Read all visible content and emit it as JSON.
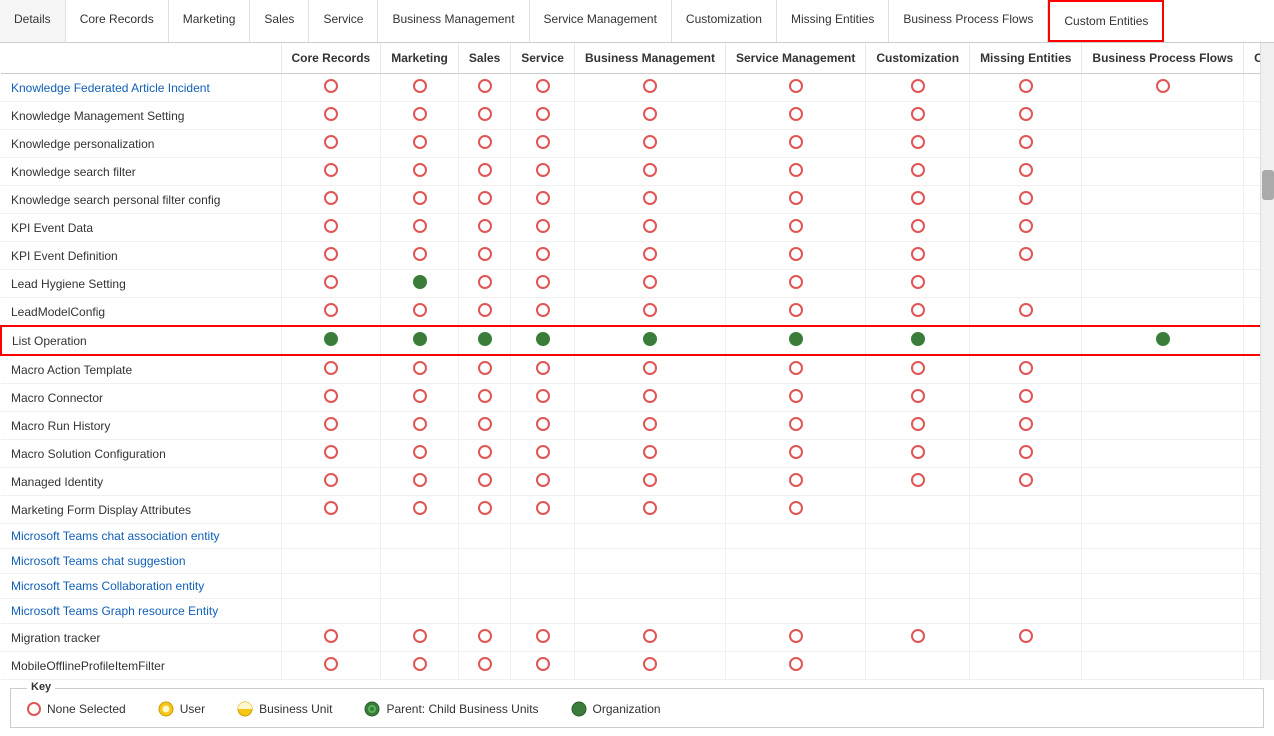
{
  "tabs": [
    {
      "id": "details",
      "label": "Details",
      "active": false
    },
    {
      "id": "core-records",
      "label": "Core Records",
      "active": false
    },
    {
      "id": "marketing",
      "label": "Marketing",
      "active": false
    },
    {
      "id": "sales",
      "label": "Sales",
      "active": false
    },
    {
      "id": "service",
      "label": "Service",
      "active": false
    },
    {
      "id": "business-management",
      "label": "Business Management",
      "active": false
    },
    {
      "id": "service-management",
      "label": "Service Management",
      "active": false
    },
    {
      "id": "customization",
      "label": "Customization",
      "active": false
    },
    {
      "id": "missing-entities",
      "label": "Missing Entities",
      "active": false
    },
    {
      "id": "business-process-flows",
      "label": "Business Process Flows",
      "active": false
    },
    {
      "id": "custom-entities",
      "label": "Custom Entities",
      "active": false,
      "highlighted": true
    }
  ],
  "columns": [
    "Core Records",
    "Marketing",
    "Sales",
    "Service",
    "Business Management",
    "Service Management",
    "Customization",
    "Missing Entities",
    "Business Process Flows",
    "Custom Entities"
  ],
  "rows": [
    {
      "name": "Knowledge Federated Article Incident",
      "nameType": "blue-link",
      "circles": [
        "none",
        "none",
        "none",
        "none",
        "none",
        "none",
        "none",
        "none",
        "none",
        ""
      ]
    },
    {
      "name": "Knowledge Management Setting",
      "nameType": "black",
      "circles": [
        "none",
        "none",
        "none",
        "none",
        "none",
        "none",
        "none",
        "none",
        "",
        ""
      ]
    },
    {
      "name": "Knowledge personalization",
      "nameType": "black",
      "circles": [
        "none",
        "none",
        "none",
        "none",
        "none",
        "none",
        "none",
        "none",
        "",
        ""
      ]
    },
    {
      "name": "Knowledge search filter",
      "nameType": "black",
      "circles": [
        "none",
        "none",
        "none",
        "none",
        "none",
        "none",
        "none",
        "none",
        "",
        ""
      ]
    },
    {
      "name": "Knowledge search personal filter config",
      "nameType": "black",
      "circles": [
        "none",
        "none",
        "none",
        "none",
        "none",
        "none",
        "none",
        "none",
        "",
        ""
      ]
    },
    {
      "name": "KPI Event Data",
      "nameType": "black",
      "circles": [
        "none",
        "none",
        "none",
        "none",
        "none",
        "none",
        "none",
        "none",
        "",
        ""
      ]
    },
    {
      "name": "KPI Event Definition",
      "nameType": "black",
      "circles": [
        "none",
        "none",
        "none",
        "none",
        "none",
        "none",
        "none",
        "none",
        "",
        ""
      ]
    },
    {
      "name": "Lead Hygiene Setting",
      "nameType": "black",
      "circles": [
        "none",
        "green",
        "none",
        "none",
        "none",
        "none",
        "none",
        "",
        "",
        ""
      ]
    },
    {
      "name": "LeadModelConfig",
      "nameType": "black",
      "circles": [
        "none",
        "none",
        "none",
        "none",
        "none",
        "none",
        "none",
        "none",
        "",
        ""
      ]
    },
    {
      "name": "List Operation",
      "nameType": "black",
      "circles": [
        "green",
        "green",
        "green",
        "green",
        "green",
        "green",
        "green",
        "",
        "green",
        ""
      ],
      "highlighted": true
    },
    {
      "name": "Macro Action Template",
      "nameType": "black",
      "circles": [
        "none",
        "none",
        "none",
        "none",
        "none",
        "none",
        "none",
        "none",
        "",
        ""
      ]
    },
    {
      "name": "Macro Connector",
      "nameType": "black",
      "circles": [
        "none",
        "none",
        "none",
        "none",
        "none",
        "none",
        "none",
        "none",
        "",
        ""
      ]
    },
    {
      "name": "Macro Run History",
      "nameType": "black",
      "circles": [
        "none",
        "none",
        "none",
        "none",
        "none",
        "none",
        "none",
        "none",
        "",
        ""
      ]
    },
    {
      "name": "Macro Solution Configuration",
      "nameType": "black",
      "circles": [
        "none",
        "none",
        "none",
        "none",
        "none",
        "none",
        "none",
        "none",
        "",
        ""
      ]
    },
    {
      "name": "Managed Identity",
      "nameType": "black",
      "circles": [
        "none",
        "none",
        "none",
        "none",
        "none",
        "none",
        "none",
        "none",
        "",
        ""
      ]
    },
    {
      "name": "Marketing Form Display Attributes",
      "nameType": "black",
      "circles": [
        "none",
        "none",
        "none",
        "none",
        "none",
        "none",
        "",
        "",
        "",
        ""
      ]
    },
    {
      "name": "Microsoft Teams chat association entity",
      "nameType": "blue-link",
      "circles": [
        "",
        "",
        "",
        "",
        "",
        "",
        "",
        "",
        "",
        ""
      ]
    },
    {
      "name": "Microsoft Teams chat suggestion",
      "nameType": "blue-link",
      "circles": [
        "",
        "",
        "",
        "",
        "",
        "",
        "",
        "",
        "",
        ""
      ]
    },
    {
      "name": "Microsoft Teams Collaboration entity",
      "nameType": "blue-link",
      "circles": [
        "",
        "",
        "",
        "",
        "",
        "",
        "",
        "",
        "",
        ""
      ]
    },
    {
      "name": "Microsoft Teams Graph resource Entity",
      "nameType": "blue-link",
      "circles": [
        "",
        "",
        "",
        "",
        "",
        "",
        "",
        "",
        "",
        ""
      ]
    },
    {
      "name": "Migration tracker",
      "nameType": "black",
      "circles": [
        "none",
        "none",
        "none",
        "none",
        "none",
        "none",
        "none",
        "none",
        "",
        ""
      ]
    },
    {
      "name": "MobileOfflineProfileItemFilter",
      "nameType": "black",
      "circles": [
        "none",
        "none",
        "none",
        "none",
        "none",
        "none",
        "",
        "",
        "",
        ""
      ]
    }
  ],
  "key": {
    "title": "Key",
    "items": [
      {
        "label": "None Selected",
        "type": "none"
      },
      {
        "label": "User",
        "type": "user"
      },
      {
        "label": "Business Unit",
        "type": "bu"
      },
      {
        "label": "Parent: Child Business Units",
        "type": "parent"
      },
      {
        "label": "Organization",
        "type": "org"
      }
    ]
  }
}
